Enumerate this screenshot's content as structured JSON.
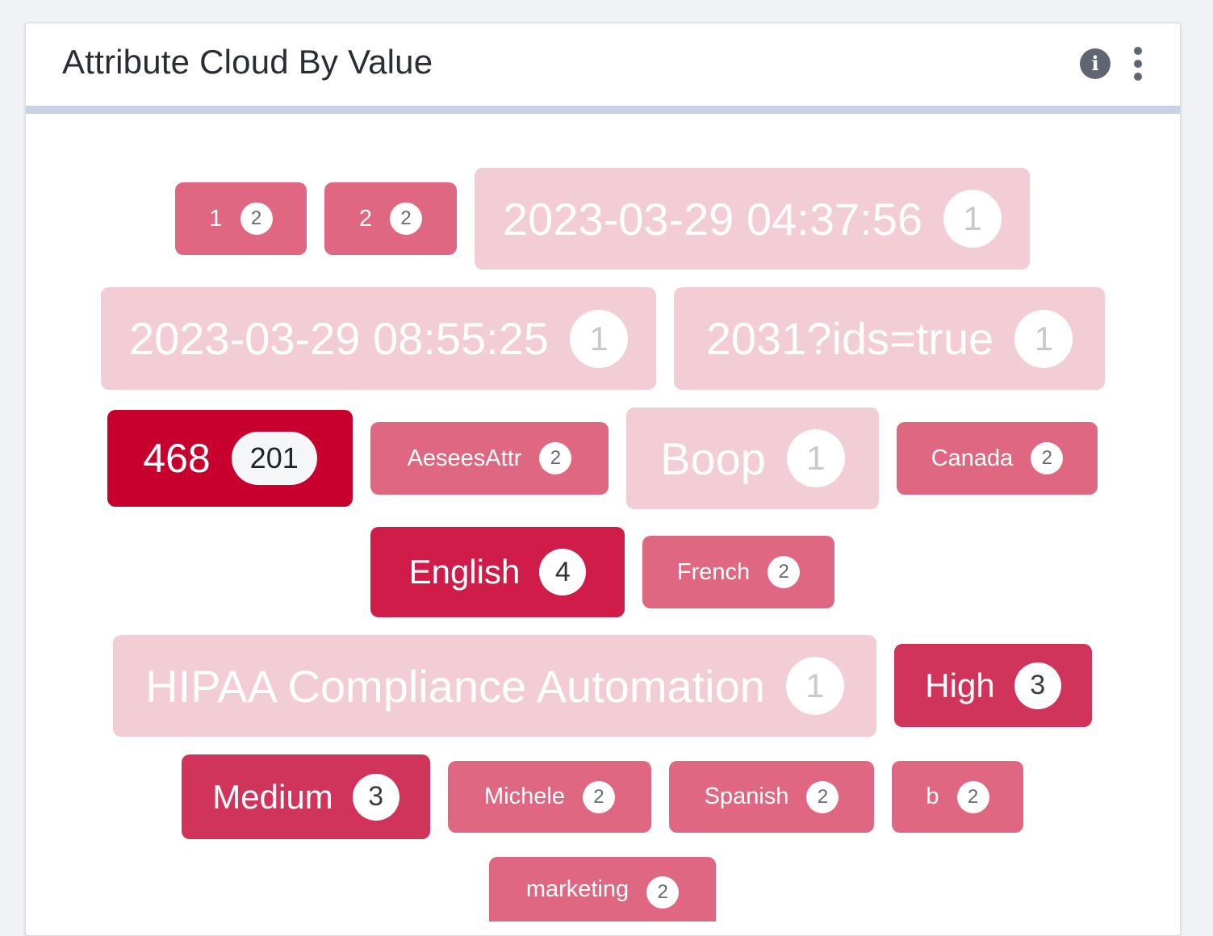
{
  "widget": {
    "title": "Attribute Cloud By Value",
    "info_icon": "info-icon",
    "menu_icon": "kebab-menu-icon",
    "header_accent_color": "#c7d2e6"
  },
  "levels": {
    "faint": "#f3cdd6",
    "mid": "#e06781",
    "strong": "#d0345a",
    "stronger": "#cf1c48",
    "max": "#c8002e"
  },
  "tags": [
    {
      "label": "1",
      "count": "2"
    },
    {
      "label": "2",
      "count": "2"
    },
    {
      "label": "2023-03-29 04:37:56",
      "count": "1"
    },
    {
      "label": "2023-03-29 08:55:25",
      "count": "1"
    },
    {
      "label": "2031?ids=true",
      "count": "1"
    },
    {
      "label": "468",
      "count": "201"
    },
    {
      "label": "AeseesAttr",
      "count": "2"
    },
    {
      "label": "Boop",
      "count": "1"
    },
    {
      "label": "Canada",
      "count": "2"
    },
    {
      "label": "English",
      "count": "4"
    },
    {
      "label": "French",
      "count": "2"
    },
    {
      "label": "HIPAA Compliance Automation",
      "count": "1"
    },
    {
      "label": "High",
      "count": "3"
    },
    {
      "label": "Medium",
      "count": "3"
    },
    {
      "label": "Michele",
      "count": "2"
    },
    {
      "label": "Spanish",
      "count": "2"
    },
    {
      "label": "b",
      "count": "2"
    },
    {
      "label": "marketing",
      "count": "2"
    }
  ]
}
